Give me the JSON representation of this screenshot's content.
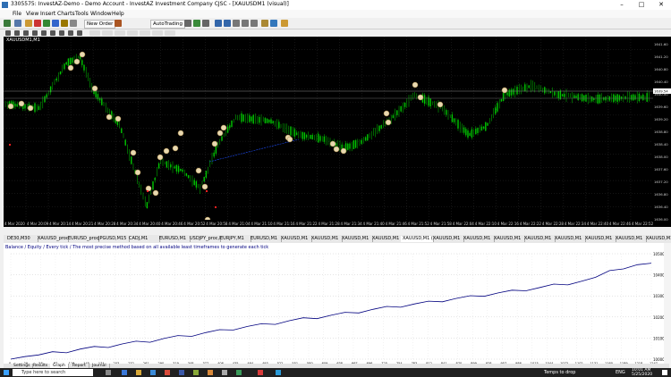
{
  "window": {
    "title": "3305575: InvestAZ-Demo - Demo Account - InvestAZ Investment Company CJSC - [XAUUSDM1 (visual)]"
  },
  "menu": [
    "File",
    "View",
    "Insert",
    "Charts",
    "Tools",
    "Window",
    "Help"
  ],
  "toolbar": {
    "new_order": "New Order",
    "autotrading": "AutoTrading"
  },
  "chart": {
    "symbol_label": "XAUUSDM1,M1",
    "time_labels": [
      "4 Mar 2020",
      "4 Mar 20:09",
      "4 Mar 20:14",
      "4 Mar 20:21",
      "4 Mar 20:28",
      "4 Mar 20:34",
      "4 Mar 20:40",
      "4 Mar 20:46",
      "4 Mar 20:52",
      "4 Mar 20:58",
      "4 Mar 21:04",
      "4 Mar 21:10",
      "4 Mar 21:16",
      "4 Mar 21:22",
      "4 Mar 21:28",
      "4 Mar 21:34",
      "4 Mar 21:40",
      "4 Mar 21:46",
      "4 Mar 21:52",
      "4 Mar 21:58",
      "4 Mar 22:04",
      "4 Mar 22:10",
      "4 Mar 22:16",
      "4 Mar 22:22",
      "4 Mar 22:28",
      "4 Mar 22:34",
      "4 Mar 22:40",
      "4 Mar 22:46",
      "4 Mar 22:52"
    ],
    "price_labels": [
      "1641.60",
      "1641.20",
      "1640.80",
      "1640.40",
      "1640.00",
      "1639.60",
      "1639.20",
      "1638.80",
      "1638.40",
      "1638.00",
      "1637.60",
      "1637.20",
      "1636.80",
      "1636.40",
      "1636.00"
    ],
    "current_price": "1639.54"
  },
  "chart_tabs": [
    "DE30,M30",
    "XAUUSD_proc,M1",
    "EURUSD_proc,M15",
    "JPGUSD,M15",
    "CADJ,M1",
    "EURUSD,M1",
    "USDJPY_proc,M1",
    "EURJPY,M1",
    "EURUSD,M1",
    "XAUUSD,M1",
    "XAUUSD,M1",
    "XAUUSD,M1",
    "XAUUSD,M1",
    "XAUUSD,M1 (visual)",
    "XAUUSD,M1",
    "XAUUSD,M1",
    "XAUUSD,M1",
    "XAUUSD,M1",
    "XAUUSD,M1",
    "XAUUSD,M1",
    "XAUUSD,M1",
    "XAUUSD,M1"
  ],
  "tester": {
    "header": "Balance / Equity / Every tick / The most precise method based on all available least timeframes to generate each tick",
    "y_labels": [
      "10500",
      "10400",
      "10300",
      "10200",
      "10100",
      "10000"
    ],
    "x_labels": [
      "0",
      "29",
      "58",
      "87",
      "116",
      "145",
      "174",
      "203",
      "232",
      "261",
      "290",
      "319",
      "348",
      "377",
      "406",
      "435",
      "464",
      "493",
      "522",
      "551",
      "580",
      "609",
      "638",
      "667",
      "696",
      "725",
      "754",
      "783",
      "812",
      "841",
      "870",
      "899",
      "928",
      "957",
      "986",
      "1015",
      "1044",
      "1073",
      "1102",
      "1131",
      "1160",
      "1189",
      "1218",
      "1247"
    ],
    "balance_values": [
      10000,
      10012,
      10020,
      10035,
      10030,
      10048,
      10060,
      10055,
      10072,
      10085,
      10080,
      10098,
      10112,
      10108,
      10126,
      10140,
      10138,
      10155,
      10168,
      10165,
      10182,
      10196,
      10192,
      10208,
      10222,
      10219,
      10236,
      10250,
      10246,
      10262,
      10275,
      10272,
      10288,
      10301,
      10298,
      10314,
      10327,
      10324,
      10340,
      10356,
      10352,
      10370,
      10388,
      10420,
      10428,
      10448,
      10455
    ]
  },
  "bottom_tabs": [
    "Settings",
    "Results",
    "Graph",
    "Report",
    "Journal"
  ],
  "taskbar": {
    "search_placeholder": "Type here to search",
    "weather": "Temps to drop",
    "lang": "ENG",
    "time": "10:01 AM",
    "date": "5/25/2020"
  },
  "colors": {
    "chart_bg": "#000000",
    "bull_candle": "#00c800",
    "balance_line": "#00007f"
  }
}
